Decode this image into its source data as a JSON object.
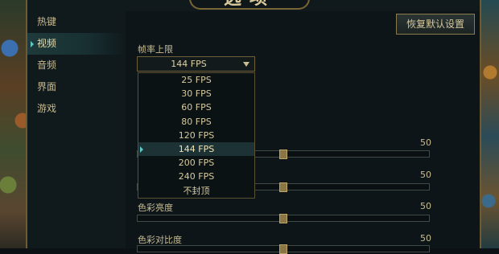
{
  "window": {
    "title": "选项"
  },
  "sidebar": {
    "items": [
      {
        "label": "热键",
        "active": false
      },
      {
        "label": "视频",
        "active": true
      },
      {
        "label": "音频",
        "active": false
      },
      {
        "label": "界面",
        "active": false
      },
      {
        "label": "游戏",
        "active": false
      }
    ]
  },
  "toolbar": {
    "reset_label": "恢复默认设置"
  },
  "framerate": {
    "label": "帧率上限",
    "selected": "144 FPS",
    "options": [
      "25 FPS",
      "30 FPS",
      "60 FPS",
      "80 FPS",
      "120 FPS",
      "144 FPS",
      "200 FPS",
      "240 FPS",
      "不封顶"
    ],
    "selected_index": 5
  },
  "sliders": [
    {
      "label": "",
      "value": "50",
      "level": 0.5
    },
    {
      "label": "",
      "value": "50",
      "level": 0.5
    },
    {
      "label": "色彩亮度",
      "value": "50",
      "level": 0.5
    },
    {
      "label": "色彩对比度",
      "value": "50",
      "level": 0.5
    }
  ],
  "colors": {
    "accent": "#5fc9c4",
    "gold": "#c9bd92",
    "frame": "#6e5b32"
  }
}
